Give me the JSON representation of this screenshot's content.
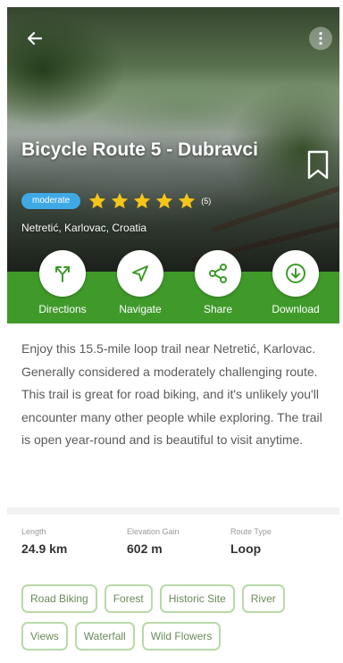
{
  "hero": {
    "title": "Bicycle Route 5 - Dubravci",
    "difficulty": "moderate",
    "rating": 5,
    "review_count": "(5)",
    "location": "Netretić, Karlovac, Croatia"
  },
  "actions": [
    {
      "label": "Directions",
      "icon": "directions-icon"
    },
    {
      "label": "Navigate",
      "icon": "navigate-icon"
    },
    {
      "label": "Share",
      "icon": "share-icon"
    },
    {
      "label": "Download",
      "icon": "download-icon"
    }
  ],
  "description": "Enjoy this 15.5-mile loop trail near Netretić, Karlovac. Generally considered a moderately challenging route. This trail is great for road biking, and it's unlikely you'll encounter many other people while exploring. The trail is open year-round and is beautiful to visit anytime.",
  "stats": [
    {
      "label": "Length",
      "value": "24.9 km"
    },
    {
      "label": "Elevation Gain",
      "value": "602 m"
    },
    {
      "label": "Route Type",
      "value": "Loop"
    }
  ],
  "tags": [
    "Road Biking",
    "Forest",
    "Historic Site",
    "River",
    "Views",
    "Waterfall",
    "Wild Flowers"
  ],
  "colors": {
    "accent_green": "#3f9a2a",
    "difficulty_blue": "#3fa9e6",
    "star_yellow": "#f5c518",
    "tag_border": "#b9d9a8"
  }
}
